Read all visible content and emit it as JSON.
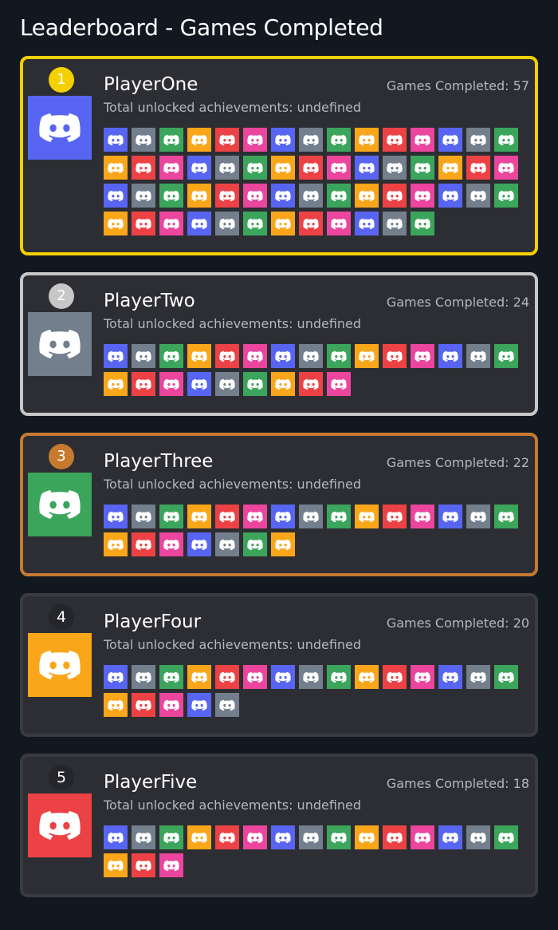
{
  "page": {
    "title": "Leaderboard - Games Completed"
  },
  "colors": {
    "gold": "#f5d000",
    "silver": "#c7c7c7",
    "bronze": "#c67a30",
    "card": "#2d2e33",
    "palette": [
      "#5865f2",
      "#747f8d",
      "#3ba55c",
      "#faa61a",
      "#ed4245",
      "#eb459e"
    ]
  },
  "players": [
    {
      "rank": "1",
      "name": "PlayerOne",
      "games_label": "Games Completed: 57",
      "achievements_label": "Total unlocked achievements: undefined",
      "avatar_color": "#5865f2",
      "games": 57
    },
    {
      "rank": "2",
      "name": "PlayerTwo",
      "games_label": "Games Completed: 24",
      "achievements_label": "Total unlocked achievements: undefined",
      "avatar_color": "#747f8d",
      "games": 24
    },
    {
      "rank": "3",
      "name": "PlayerThree",
      "games_label": "Games Completed: 22",
      "achievements_label": "Total unlocked achievements: undefined",
      "avatar_color": "#3ba55c",
      "games": 22
    },
    {
      "rank": "4",
      "name": "PlayerFour",
      "games_label": "Games Completed: 20",
      "achievements_label": "Total unlocked achievements: undefined",
      "avatar_color": "#faa61a",
      "games": 20
    },
    {
      "rank": "5",
      "name": "PlayerFive",
      "games_label": "Games Completed: 18",
      "achievements_label": "Total unlocked achievements: undefined",
      "avatar_color": "#ed4245",
      "games": 18
    }
  ],
  "icons": {
    "avatar": "discord-logo-icon",
    "game": "discord-logo-icon"
  }
}
